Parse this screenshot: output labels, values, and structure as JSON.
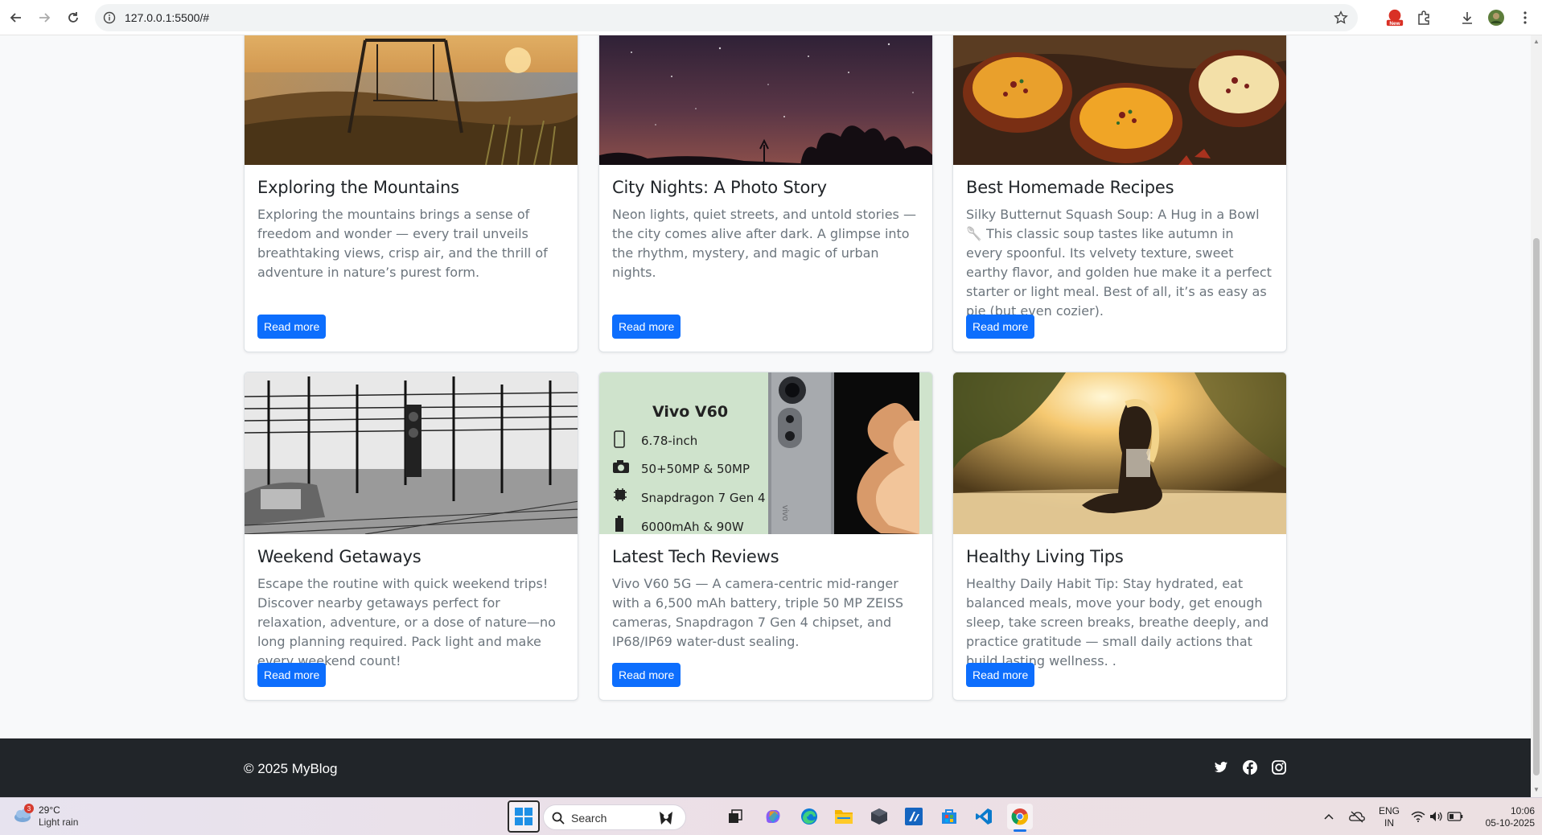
{
  "browser": {
    "url": "127.0.0.1:5500/#"
  },
  "cards": [
    {
      "title": "Exploring the Mountains",
      "text": "Exploring the mountains brings a sense of freedom and wonder — every trail unveils breathtaking views, crisp air, and the thrill of adventure in nature’s purest form.",
      "button": "Read more"
    },
    {
      "title": "City Nights: A Photo Story",
      "text": "Neon lights, quiet streets, and untold stories — the city comes alive after dark. A glimpse into the rhythm, mystery, and magic of urban nights.",
      "button": "Read more"
    },
    {
      "title": "Best Homemade Recipes",
      "text": "Silky Butternut Squash Soup: A Hug in a Bowl 🥄 This classic soup tastes like autumn in every spoonful. Its velvety texture, sweet earthy flavor, and golden hue make it a perfect starter or light meal. Best of all, it’s as easy as pie (but even cozier).",
      "button": "Read more"
    },
    {
      "title": "Weekend Getaways",
      "text": "Escape the routine with quick weekend trips! Discover nearby getaways perfect for relaxation, adventure, or a dose of nature—no long planning required. Pack light and make every weekend count!",
      "button": "Read more"
    },
    {
      "title": "Latest Tech Reviews",
      "text": "Vivo V60 5G — A camera-centric mid-ranger with a 6,500 mAh battery, triple 50 MP ZEISS cameras, Snapdragon 7 Gen 4 chipset, and IP68/IP69 water-dust sealing.",
      "button": "Read more"
    },
    {
      "title": "Healthy Living Tips",
      "text": "Healthy Daily Habit Tip: Stay hydrated, eat balanced meals, move your body, get enough sleep, take screen breaks, breathe deeply, and practice gratitude — small daily actions that build lasting wellness. .",
      "button": "Read more"
    }
  ],
  "tech_image": {
    "model": "Vivo V60",
    "specs": [
      "6.78-inch",
      "50+50MP & 50MP",
      "Snapdragon 7 Gen 4",
      "6000mAh & 90W"
    ],
    "brand_mark": "vivo"
  },
  "footer": {
    "copyright": "© 2025 MyBlog",
    "social": [
      "twitter-icon",
      "facebook-icon",
      "instagram-icon"
    ]
  },
  "taskbar": {
    "weather_temp": "29°C",
    "weather_cond": "Light rain",
    "weather_badge": "3",
    "search_label": "Search",
    "lang_line1": "ENG",
    "lang_line2": "IN",
    "time": "10:06",
    "date": "05-10-2025"
  },
  "colors": {
    "primary": "#0d6efd",
    "footer_bg": "#212529"
  }
}
